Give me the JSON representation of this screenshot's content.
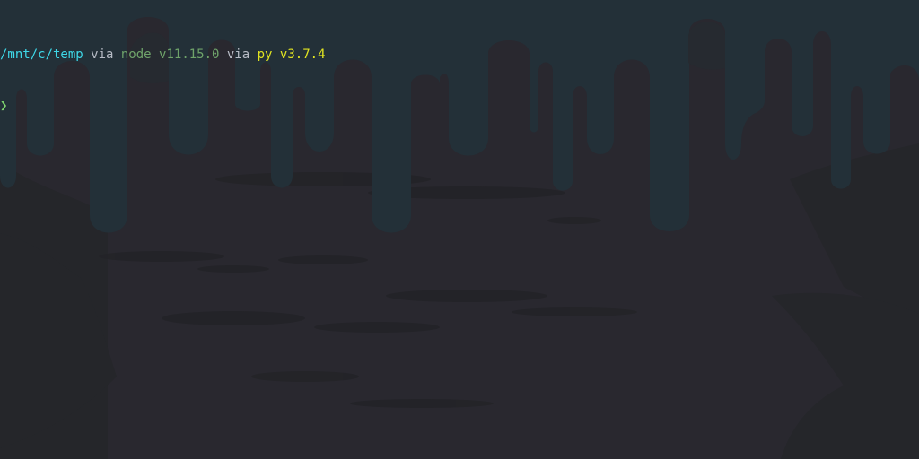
{
  "terminal": {
    "prompt": {
      "path": "/mnt/c/temp",
      "via_1": " via ",
      "node_label": "node ",
      "node_version": "v11.15.0",
      "via_2": " via ",
      "py_label": "py ",
      "py_version": "v3.7.4",
      "cursor_symbol": "❯"
    }
  },
  "colors": {
    "background": "#29282f",
    "drip": "#23313a",
    "path": "#3ed8e8",
    "node": "#6fa36a",
    "python": "#e0e321",
    "arrow": "#7ed36f",
    "text_muted": "#b7bcc6"
  },
  "icons": {
    "prompt_arrow": "chevron-right-icon"
  }
}
